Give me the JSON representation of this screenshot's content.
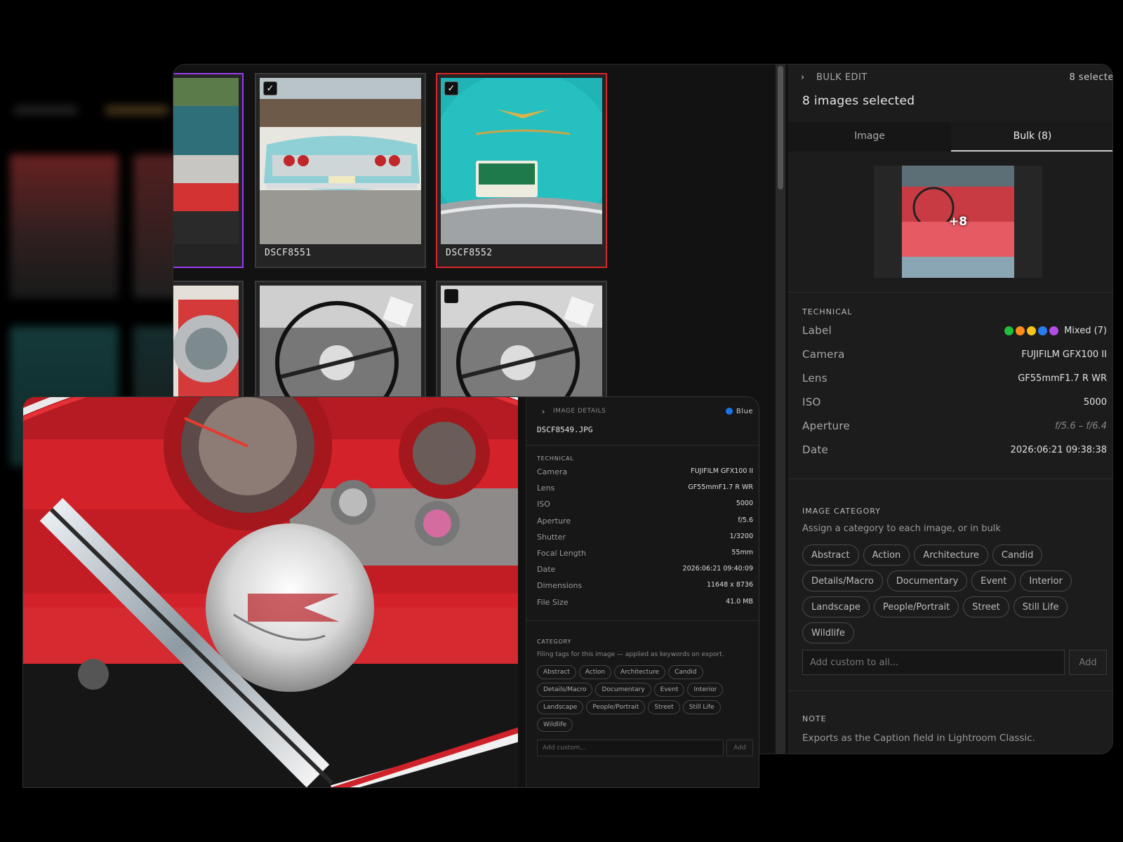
{
  "grid": {
    "cards": [
      {
        "name": "",
        "selected": "purple"
      },
      {
        "name": "DSCF8551",
        "checked": true
      },
      {
        "name": "DSCF8552",
        "checked": true,
        "selected": "red"
      }
    ]
  },
  "bulk": {
    "header": "BULK EDIT",
    "selected_count_text": "8 selecte",
    "title": "8 images selected",
    "tabs": [
      {
        "label": "Image"
      },
      {
        "label": "Bulk (8)",
        "active": true
      }
    ],
    "preview_badge": "+8",
    "technical_title": "TECHNICAL",
    "rows": [
      {
        "key": "Label",
        "value": "Mixed (7)"
      },
      {
        "key": "Camera",
        "value": "FUJIFILM GFX100 II"
      },
      {
        "key": "Lens",
        "value": "GF55mmF1.7 R WR"
      },
      {
        "key": "ISO",
        "value": "5000"
      },
      {
        "key": "Aperture",
        "value": "f/5.6 – f/6.4"
      },
      {
        "key": "Date",
        "value": "2026:06:21 09:38:38"
      }
    ],
    "label_colors": [
      "#1fbf3a",
      "#ff8c1a",
      "#f6c21b",
      "#2b7bf0",
      "#b44ce6"
    ],
    "category_title": "IMAGE CATEGORY",
    "category_hint": "Assign a category to each image, or in bulk",
    "categories": [
      "Abstract",
      "Action",
      "Architecture",
      "Candid",
      "Details/Macro",
      "Documentary",
      "Event",
      "Interior",
      "Landscape",
      "People/Portrait",
      "Street",
      "Still Life",
      "Wildlife"
    ],
    "custom_placeholder": "Add custom to all...",
    "add_label": "Add",
    "note_title": "NOTE",
    "note_text": "Exports as the Caption field in Lightroom Classic."
  },
  "details": {
    "header": "IMAGE DETAILS",
    "label": "Blue",
    "filename": "DSCF8549.JPG",
    "technical_title": "TECHNICAL",
    "rows": [
      {
        "key": "Camera",
        "value": "FUJIFILM GFX100 II"
      },
      {
        "key": "Lens",
        "value": "GF55mmF1.7 R WR"
      },
      {
        "key": "ISO",
        "value": "5000"
      },
      {
        "key": "Aperture",
        "value": "f/5.6"
      },
      {
        "key": "Shutter",
        "value": "1/3200"
      },
      {
        "key": "Focal Length",
        "value": "55mm"
      },
      {
        "key": "Date",
        "value": "2026:06:21 09:40:09"
      },
      {
        "key": "Dimensions",
        "value": "11648 x 8736"
      },
      {
        "key": "File Size",
        "value": "41.0 MB"
      }
    ],
    "category_title": "CATEGORY",
    "category_hint": "Filing tags for this image — applied as keywords on export.",
    "categories": [
      "Abstract",
      "Action",
      "Architecture",
      "Candid",
      "Details/Macro",
      "Documentary",
      "Event",
      "Interior",
      "Landscape",
      "People/Portrait",
      "Street",
      "Still Life",
      "Wildlife"
    ],
    "custom_placeholder": "Add custom...",
    "add_label": "Add"
  }
}
